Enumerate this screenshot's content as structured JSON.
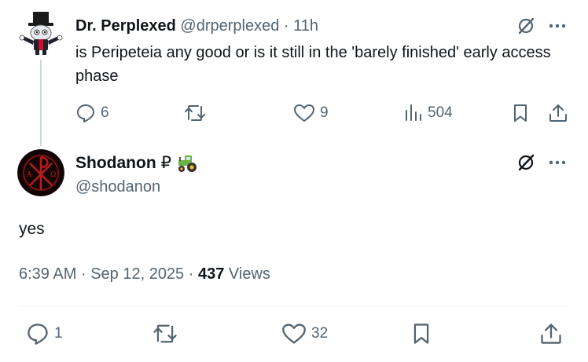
{
  "parent_tweet": {
    "display_name": "Dr. Perplexed",
    "handle": "@drperplexed",
    "separator": "·",
    "time_ago": "11h",
    "text": "is Peripeteia any good or is it still in the 'barely finished' early access phase",
    "replies": "6",
    "likes": "9",
    "views": "504",
    "icons": [
      "grok-icon",
      "more-icon",
      "reply-icon",
      "retweet-icon",
      "like-icon",
      "views-icon",
      "bookmark-icon",
      "share-icon"
    ]
  },
  "main_tweet": {
    "display_name": "Shodanon",
    "name_emoji": [
      "ruble-sign",
      "tractor-emoji"
    ],
    "ruble": "₽",
    "handle": "@shodanon",
    "text": "yes",
    "time": "6:39 AM",
    "date": "Sep 12, 2025",
    "dot": "·",
    "views_count": "437",
    "views_label": "Views",
    "replies": "1",
    "likes": "32"
  },
  "colors": {
    "text": "#0f1419",
    "muted": "#536471",
    "divider": "#eff3f4",
    "thread_line": "#cfd9de"
  }
}
